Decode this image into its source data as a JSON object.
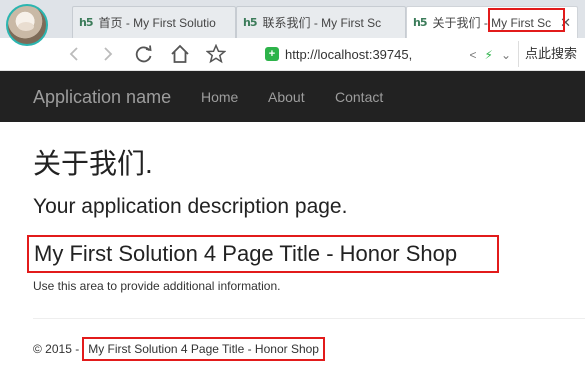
{
  "browser": {
    "tabs": [
      {
        "label": "首页 - My First Solutio",
        "active": false
      },
      {
        "label": "联系我们 - My First Sc",
        "active": false
      },
      {
        "label": "关于我们 - My First Sc",
        "active": true
      }
    ],
    "address": "http://localhost:39745,",
    "search_label": "点此搜索"
  },
  "navbar": {
    "brand": "Application name",
    "links": [
      "Home",
      "About",
      "Contact"
    ]
  },
  "page": {
    "title": "关于我们.",
    "description": "Your application description page.",
    "solution_title": "My First Solution 4 Page Title - Honor Shop",
    "info": "Use this area to provide additional information."
  },
  "footer": {
    "copyright": "© 2015 -",
    "title": "My First Solution 4 Page Title - Honor Shop"
  },
  "colors": {
    "highlight": "#e21b1b",
    "navbar_bg": "#222222",
    "nav_text": "#9d9d9d"
  }
}
